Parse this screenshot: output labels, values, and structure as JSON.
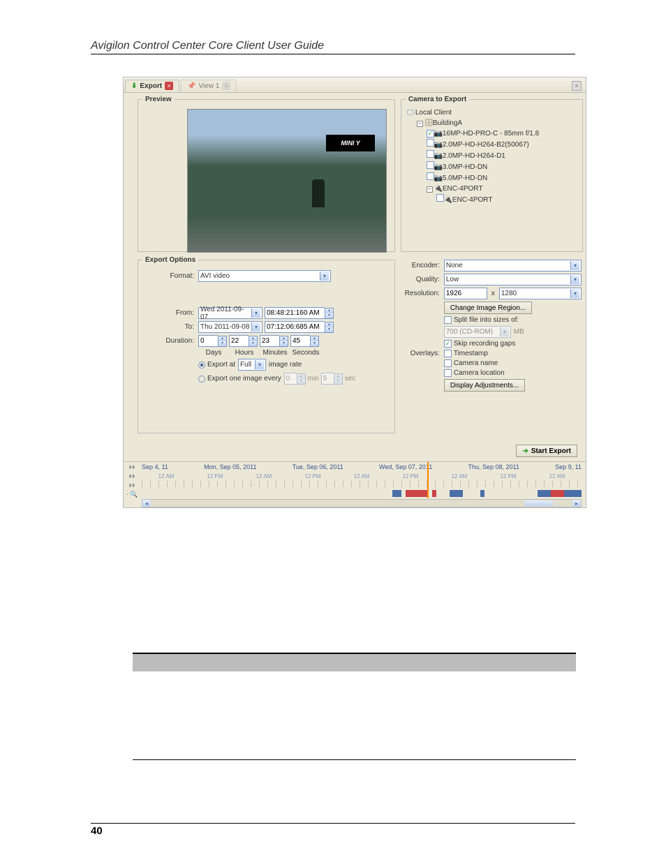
{
  "document": {
    "header": "Avigilon Control Center Core Client User Guide",
    "page_number": "40"
  },
  "table": {
    "headers": [
      "",
      ""
    ]
  },
  "app": {
    "tabs": [
      {
        "icon": "arrow-down-green",
        "label": "Export",
        "closeable": true
      },
      {
        "icon": "pushpin-blue",
        "label": "View 1",
        "closeable": true
      }
    ],
    "preview": {
      "legend": "Preview",
      "sign_text": "MINI Y"
    },
    "camera_panel": {
      "legend": "Camera to Export",
      "tree": {
        "root": {
          "label": "Local Client"
        },
        "server": {
          "label": "BuildingA"
        },
        "cameras": [
          {
            "label": "16MP-HD-PRO-C - 85mm f/1.8",
            "checked": true
          },
          {
            "label": "2.0MP-HD-H264-B2(50067)",
            "checked": false
          },
          {
            "label": "2.0MP-HD-H264-D1",
            "checked": false
          },
          {
            "label": "3.0MP-HD-DN",
            "checked": false
          },
          {
            "label": "5.0MP-HD-DN",
            "checked": false
          }
        ],
        "encoder": {
          "label": "ENC-4PORT"
        },
        "encoder_child": {
          "label": "ENC-4PORT"
        }
      }
    },
    "export_options": {
      "legend": "Export Options",
      "format_label": "Format:",
      "format_value": "AVI video",
      "from_label": "From:",
      "from_date": "Wed 2011-09-07",
      "from_time": "08:48:21:160 AM",
      "to_label": "To:",
      "to_date": "Thu 2011-09-08",
      "to_time": "07:12:06:685 AM",
      "duration_label": "Duration:",
      "duration": {
        "days": "0",
        "hours": "22",
        "minutes": "23",
        "seconds": "45"
      },
      "duration_units": {
        "days": "Days",
        "hours": "Hours",
        "minutes": "Minutes",
        "seconds": "Seconds"
      },
      "export_at_label": "Export at",
      "export_at_rate": "Full",
      "export_at_suffix": "image rate",
      "export_one_every_label": "Export one image every",
      "export_one_every_min": "0",
      "export_one_every_min_unit": "min",
      "export_one_every_sec": "5",
      "export_one_every_sec_unit": "sec",
      "encoder_label": "Encoder:",
      "encoder_value": "None",
      "quality_label": "Quality:",
      "quality_value": "Low",
      "resolution_label": "Resolution:",
      "resolution_w": "1926",
      "resolution_x": "x",
      "resolution_h": "1280",
      "change_region_btn": "Change Image Region...",
      "split_label": "Split file into sizes of:",
      "split_value": "700 (CD-ROM)",
      "split_unit": "MB",
      "skip_gaps_label": "Skip recording gaps",
      "overlays_label": "Overlays:",
      "overlays": {
        "timestamp": "Timestamp",
        "camera_name": "Camera name",
        "camera_location": "Camera location"
      },
      "display_adjustments_btn": "Display Adjustments...",
      "start_export_btn": "Start Export"
    },
    "timeline": {
      "dates": [
        "Sep 4, 11",
        "Mon, Sep 05, 2011",
        "Tue, Sep 06, 2011",
        "Wed, Sep 07, 2011",
        "Thu, Sep 08, 2011",
        "Sep 9, 11"
      ],
      "hours": [
        "12 AM",
        "12 PM",
        "12 AM",
        "12 PM",
        "12 AM",
        "12 PM",
        "12 AM",
        "12 PM",
        "12 AM"
      ]
    }
  }
}
